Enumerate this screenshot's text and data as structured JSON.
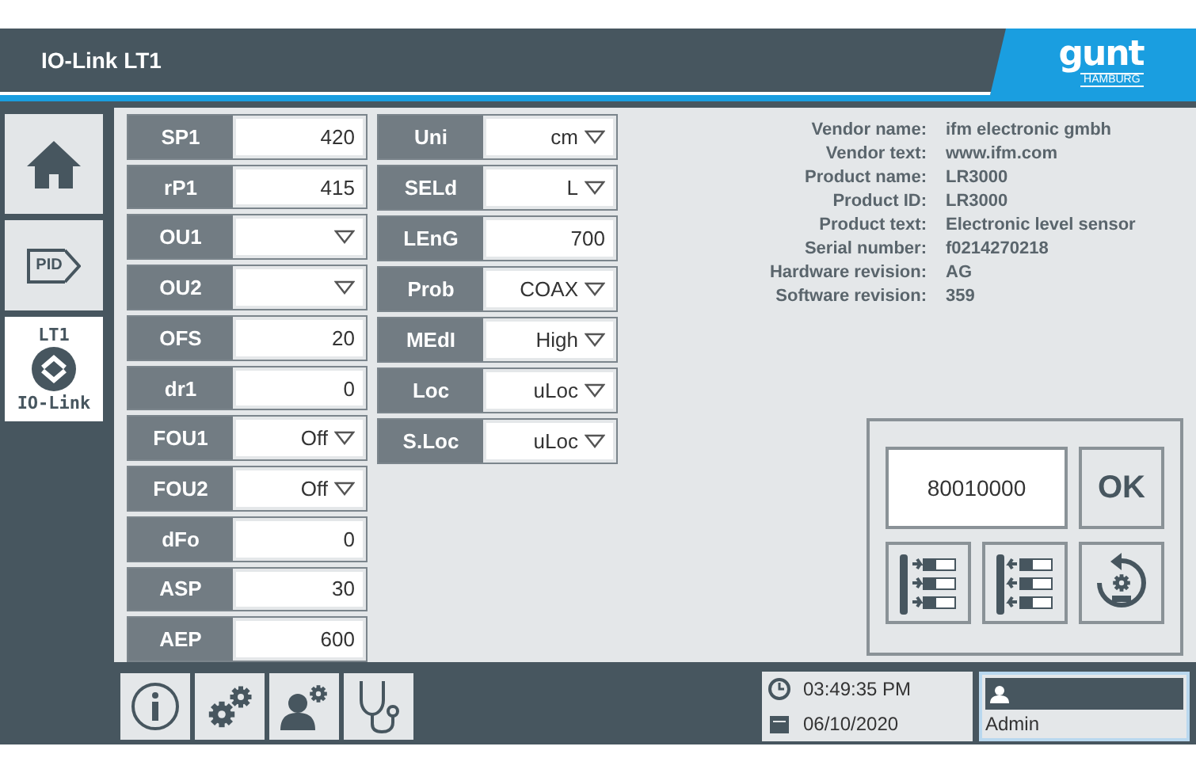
{
  "header": {
    "title": "IO-Link LT1",
    "logo": {
      "word": "gunt",
      "city": "HAMBURG"
    }
  },
  "sidebar": {
    "items": [
      {
        "kind": "home",
        "selected": false
      },
      {
        "kind": "pid",
        "label": "PID",
        "selected": false
      },
      {
        "kind": "iolink",
        "label": "LT1",
        "caption": "IO-Link",
        "selected": true
      }
    ]
  },
  "parameters": {
    "columns": [
      [
        {
          "label": "SP1",
          "value": "420",
          "kind": "number"
        },
        {
          "label": "rP1",
          "value": "415",
          "kind": "number"
        },
        {
          "label": "OU1",
          "kind": "dropdown"
        },
        {
          "label": "OU2",
          "kind": "dropdown"
        },
        {
          "label": "OFS",
          "value": "20",
          "kind": "number"
        },
        {
          "label": "dr1",
          "value": "0",
          "kind": "number"
        },
        {
          "label": "FOU1",
          "value": "Off",
          "kind": "dropdown"
        },
        {
          "label": "FOU2",
          "value": "Off",
          "kind": "dropdown"
        },
        {
          "label": "dFo",
          "value": "0",
          "kind": "number"
        },
        {
          "label": "ASP",
          "value": "30",
          "kind": "number"
        },
        {
          "label": "AEP",
          "value": "600",
          "kind": "number"
        }
      ],
      [
        {
          "label": "Uni",
          "value": "cm",
          "kind": "dropdown"
        },
        {
          "label": "SELd",
          "value": "L",
          "kind": "dropdown"
        },
        {
          "label": "LEnG",
          "value": "700",
          "kind": "number"
        },
        {
          "label": "Prob",
          "value": "COAX",
          "kind": "dropdown"
        },
        {
          "label": "MEdI",
          "value": "High",
          "kind": "dropdown"
        },
        {
          "label": "Loc",
          "value": "uLoc",
          "kind": "dropdown"
        },
        {
          "label": "S.Loc",
          "value": "uLoc",
          "kind": "dropdown"
        }
      ]
    ]
  },
  "device_info": [
    {
      "label": "Vendor name:",
      "value": "ifm electronic gmbh"
    },
    {
      "label": "Vendor text:",
      "value": "www.ifm.com"
    },
    {
      "label": "Product name:",
      "value": "LR3000"
    },
    {
      "label": "Product ID:",
      "value": "LR3000"
    },
    {
      "label": "Product text:",
      "value": "Electronic level sensor"
    },
    {
      "label": "Serial number:",
      "value": "f0214270218"
    },
    {
      "label": "Hardware revision:",
      "value": "AG"
    },
    {
      "label": "Software revision:",
      "value": "359"
    }
  ],
  "command": {
    "value": "80010000",
    "ok": "OK",
    "actions": [
      {
        "kind": "read"
      },
      {
        "kind": "write"
      },
      {
        "kind": "reset"
      }
    ]
  },
  "footer": {
    "buttons": [
      {
        "kind": "info"
      },
      {
        "kind": "gears"
      },
      {
        "kind": "user-settings"
      },
      {
        "kind": "diagnostics"
      }
    ],
    "time": "03:49:35 PM",
    "date": "06/10/2020",
    "user": "Admin"
  }
}
